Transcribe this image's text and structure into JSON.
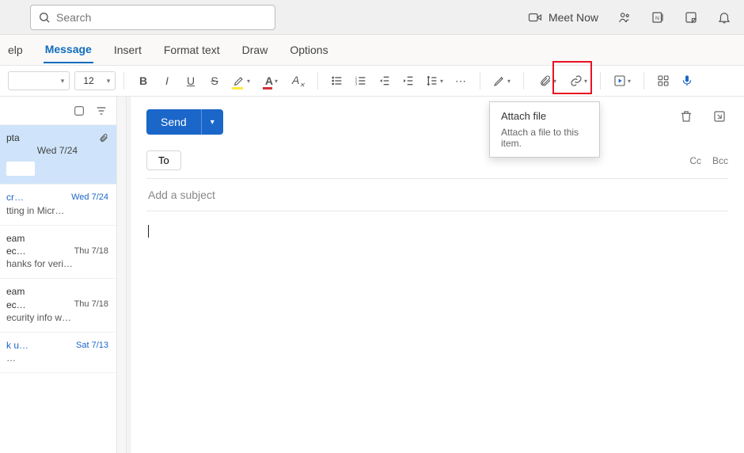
{
  "search": {
    "placeholder": "Search"
  },
  "top_right": {
    "meet_now": "Meet Now"
  },
  "tabs": {
    "help": "elp",
    "message": "Message",
    "insert": "Insert",
    "format_text": "Format text",
    "draw": "Draw",
    "options": "Options"
  },
  "toolbar": {
    "font_size": "12",
    "more": "⋯"
  },
  "tooltip": {
    "title": "Attach file",
    "body": "Attach a file to this item."
  },
  "mail_list": {
    "items": [
      {
        "sender": "pta",
        "date": "Wed 7/24",
        "preview": "",
        "has_attach": true,
        "selected": true
      },
      {
        "sender": "cr…",
        "date": "Wed 7/24",
        "preview": "tting in Micr…",
        "link": true
      },
      {
        "sender": "eam",
        "date": "Thu 7/18",
        "preview2": "hanks for veri…",
        "sub": "ec…"
      },
      {
        "sender": "eam",
        "date": "Thu 7/18",
        "preview2": "ecurity info w…",
        "sub": "ec…"
      },
      {
        "sender": "k u…",
        "date": "Sat 7/13",
        "preview": "…",
        "link": true
      }
    ]
  },
  "compose": {
    "send": "Send",
    "to": "To",
    "cc": "Cc",
    "bcc": "Bcc",
    "subject_placeholder": "Add a subject"
  }
}
